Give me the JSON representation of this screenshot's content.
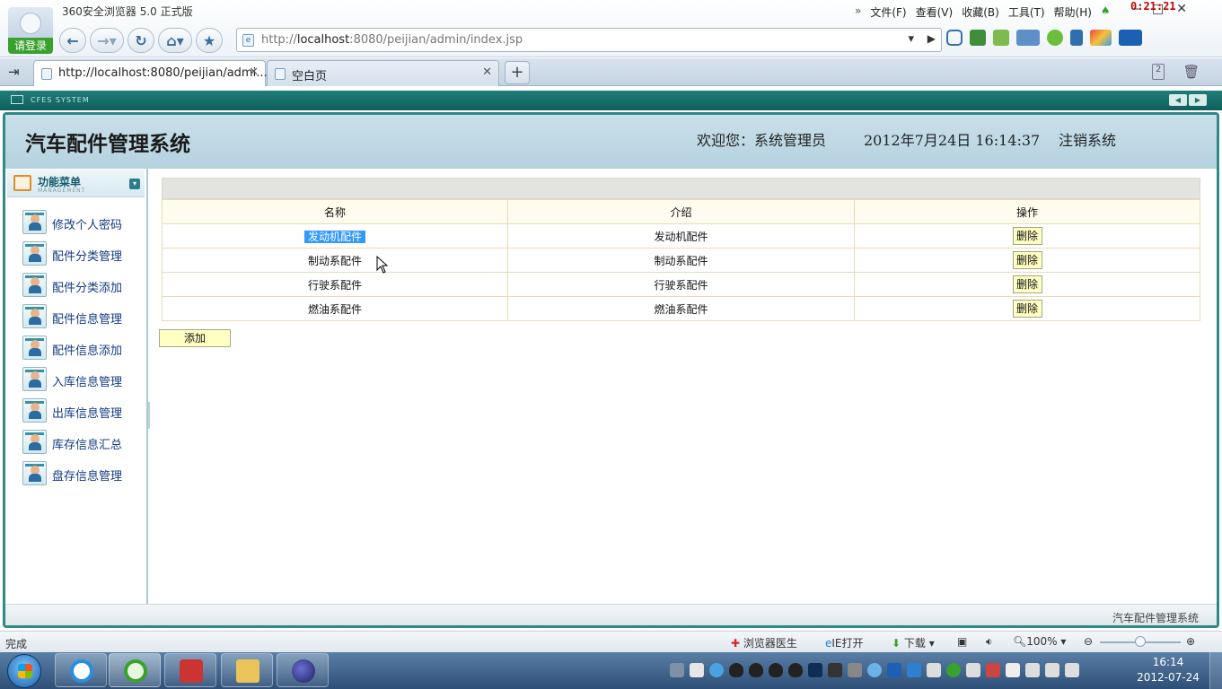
{
  "browser": {
    "app_title": "360安全浏览器 5.0 正式版",
    "login_label": "请登录",
    "menu": [
      "文件(F)",
      "查看(V)",
      "收藏(B)",
      "工具(T)",
      "帮助(H)"
    ],
    "timer": "0:21:21",
    "url_prefix": "http://",
    "url_host": "localhost",
    "url_rest": ":8080/peijian/admin/index.jsp",
    "tabs": [
      {
        "label": "http://localhost:8080/peijian/admi...",
        "active": true
      },
      {
        "label": "空白页",
        "active": false
      }
    ],
    "tab_count_badge": "2"
  },
  "app": {
    "cfes_label": "CFES SYSTEM",
    "title": "汽车配件管理系统",
    "welcome": "欢迎您：系统管理员",
    "datetime": "2012年7月24日 16:14:37",
    "logout": "注销系统",
    "sidebar": {
      "title": "功能菜单",
      "subtitle": "MANAGEMENT",
      "items": [
        {
          "label": "修改个人密码"
        },
        {
          "label": "配件分类管理"
        },
        {
          "label": "配件分类添加"
        },
        {
          "label": "配件信息管理"
        },
        {
          "label": "配件信息添加"
        },
        {
          "label": "入库信息管理"
        },
        {
          "label": "出库信息管理"
        },
        {
          "label": "库存信息汇总"
        },
        {
          "label": "盘存信息管理"
        }
      ]
    },
    "table": {
      "columns": [
        "名称",
        "介绍",
        "操作"
      ],
      "rows": [
        {
          "name": "发动机配件",
          "intro": "发动机配件",
          "action": "删除"
        },
        {
          "name": "制动系配件",
          "intro": "制动系配件",
          "action": "删除"
        },
        {
          "name": "行驶系配件",
          "intro": "行驶系配件",
          "action": "删除"
        },
        {
          "name": "燃油系配件",
          "intro": "燃油系配件",
          "action": "删除"
        }
      ]
    },
    "add_button": "添加",
    "footer": "汽车配件管理系统"
  },
  "statusbar": {
    "status": "完成",
    "doctor": "浏览器医生",
    "ie_open": "IE打开",
    "download": "下载",
    "zoom": "100%"
  },
  "taskbar": {
    "time": "16:14",
    "date": "2012-07-24"
  },
  "colors": {
    "teal_bar": "#1f7d79",
    "header_bg": "#c9e0ea",
    "button_yellow": "#ffffc2",
    "selection": "#3399ff",
    "menu_link": "#123a82"
  }
}
